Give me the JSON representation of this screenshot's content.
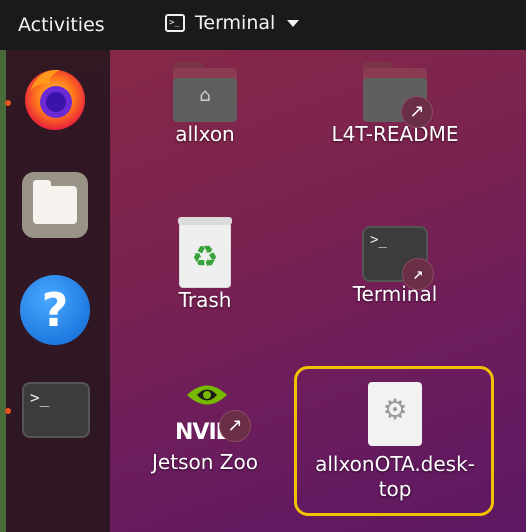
{
  "topbar": {
    "activities_label": "Activities",
    "app_menu_label": "Terminal",
    "app_icon_glyph": ">_"
  },
  "dock": {
    "items": [
      {
        "name": "firefox",
        "running": true
      },
      {
        "name": "files",
        "running": false
      },
      {
        "name": "help",
        "glyph": "?",
        "running": false
      },
      {
        "name": "terminal",
        "glyph": ">_",
        "running": true
      }
    ]
  },
  "desktop": {
    "icons": [
      {
        "label": "allxon",
        "type": "home-folder"
      },
      {
        "label": "L4T-README",
        "type": "folder-link"
      },
      {
        "label": "Trash",
        "type": "trash"
      },
      {
        "label": "Terminal",
        "type": "terminal-link",
        "glyph": ">_"
      },
      {
        "label": "Jetson Zoo",
        "type": "nvidia-link",
        "logo_text": "NVIL"
      },
      {
        "label_line1": "allxonOTA.desk-",
        "label_line2": "top",
        "type": "desktop-file",
        "selected": true
      }
    ]
  },
  "colors": {
    "highlight": "#f2c200",
    "accent_dot": "#e95420",
    "topbar_bg": "#1a1a1a"
  }
}
